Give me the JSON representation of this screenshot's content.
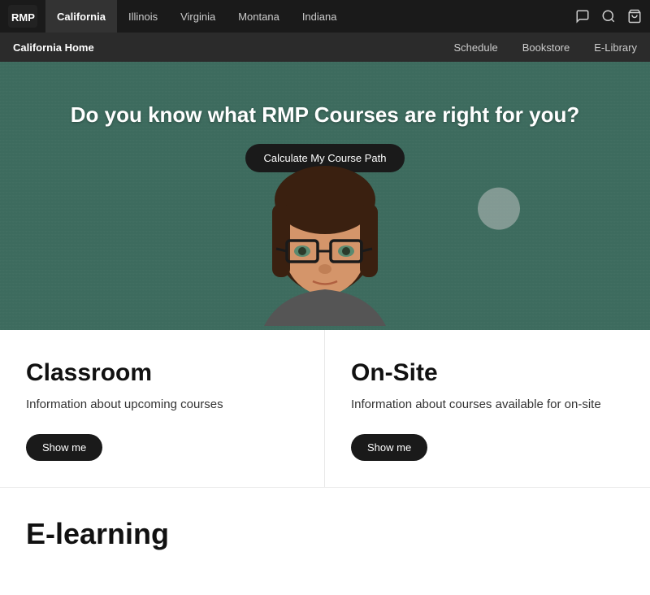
{
  "topNav": {
    "logo_label": "RMP",
    "links": [
      {
        "label": "California",
        "active": true
      },
      {
        "label": "Illinois",
        "active": false
      },
      {
        "label": "Virginia",
        "active": false
      },
      {
        "label": "Montana",
        "active": false
      },
      {
        "label": "Indiana",
        "active": false
      }
    ],
    "icons": [
      "chat-icon",
      "search-icon",
      "cart-icon"
    ]
  },
  "secondaryNav": {
    "home_label": "California Home",
    "links": [
      {
        "label": "Schedule"
      },
      {
        "label": "Bookstore"
      },
      {
        "label": "E-Library"
      }
    ]
  },
  "hero": {
    "title": "Do you know what RMP Courses are right for you?",
    "button_label": "Calculate My Course Path"
  },
  "cards": [
    {
      "title": "Classroom",
      "description": "Information about upcoming courses",
      "button_label": "Show me"
    },
    {
      "title": "On-Site",
      "description": "Information about courses available for on-site",
      "button_label": "Show me"
    }
  ],
  "elearning": {
    "title": "E-learning"
  }
}
